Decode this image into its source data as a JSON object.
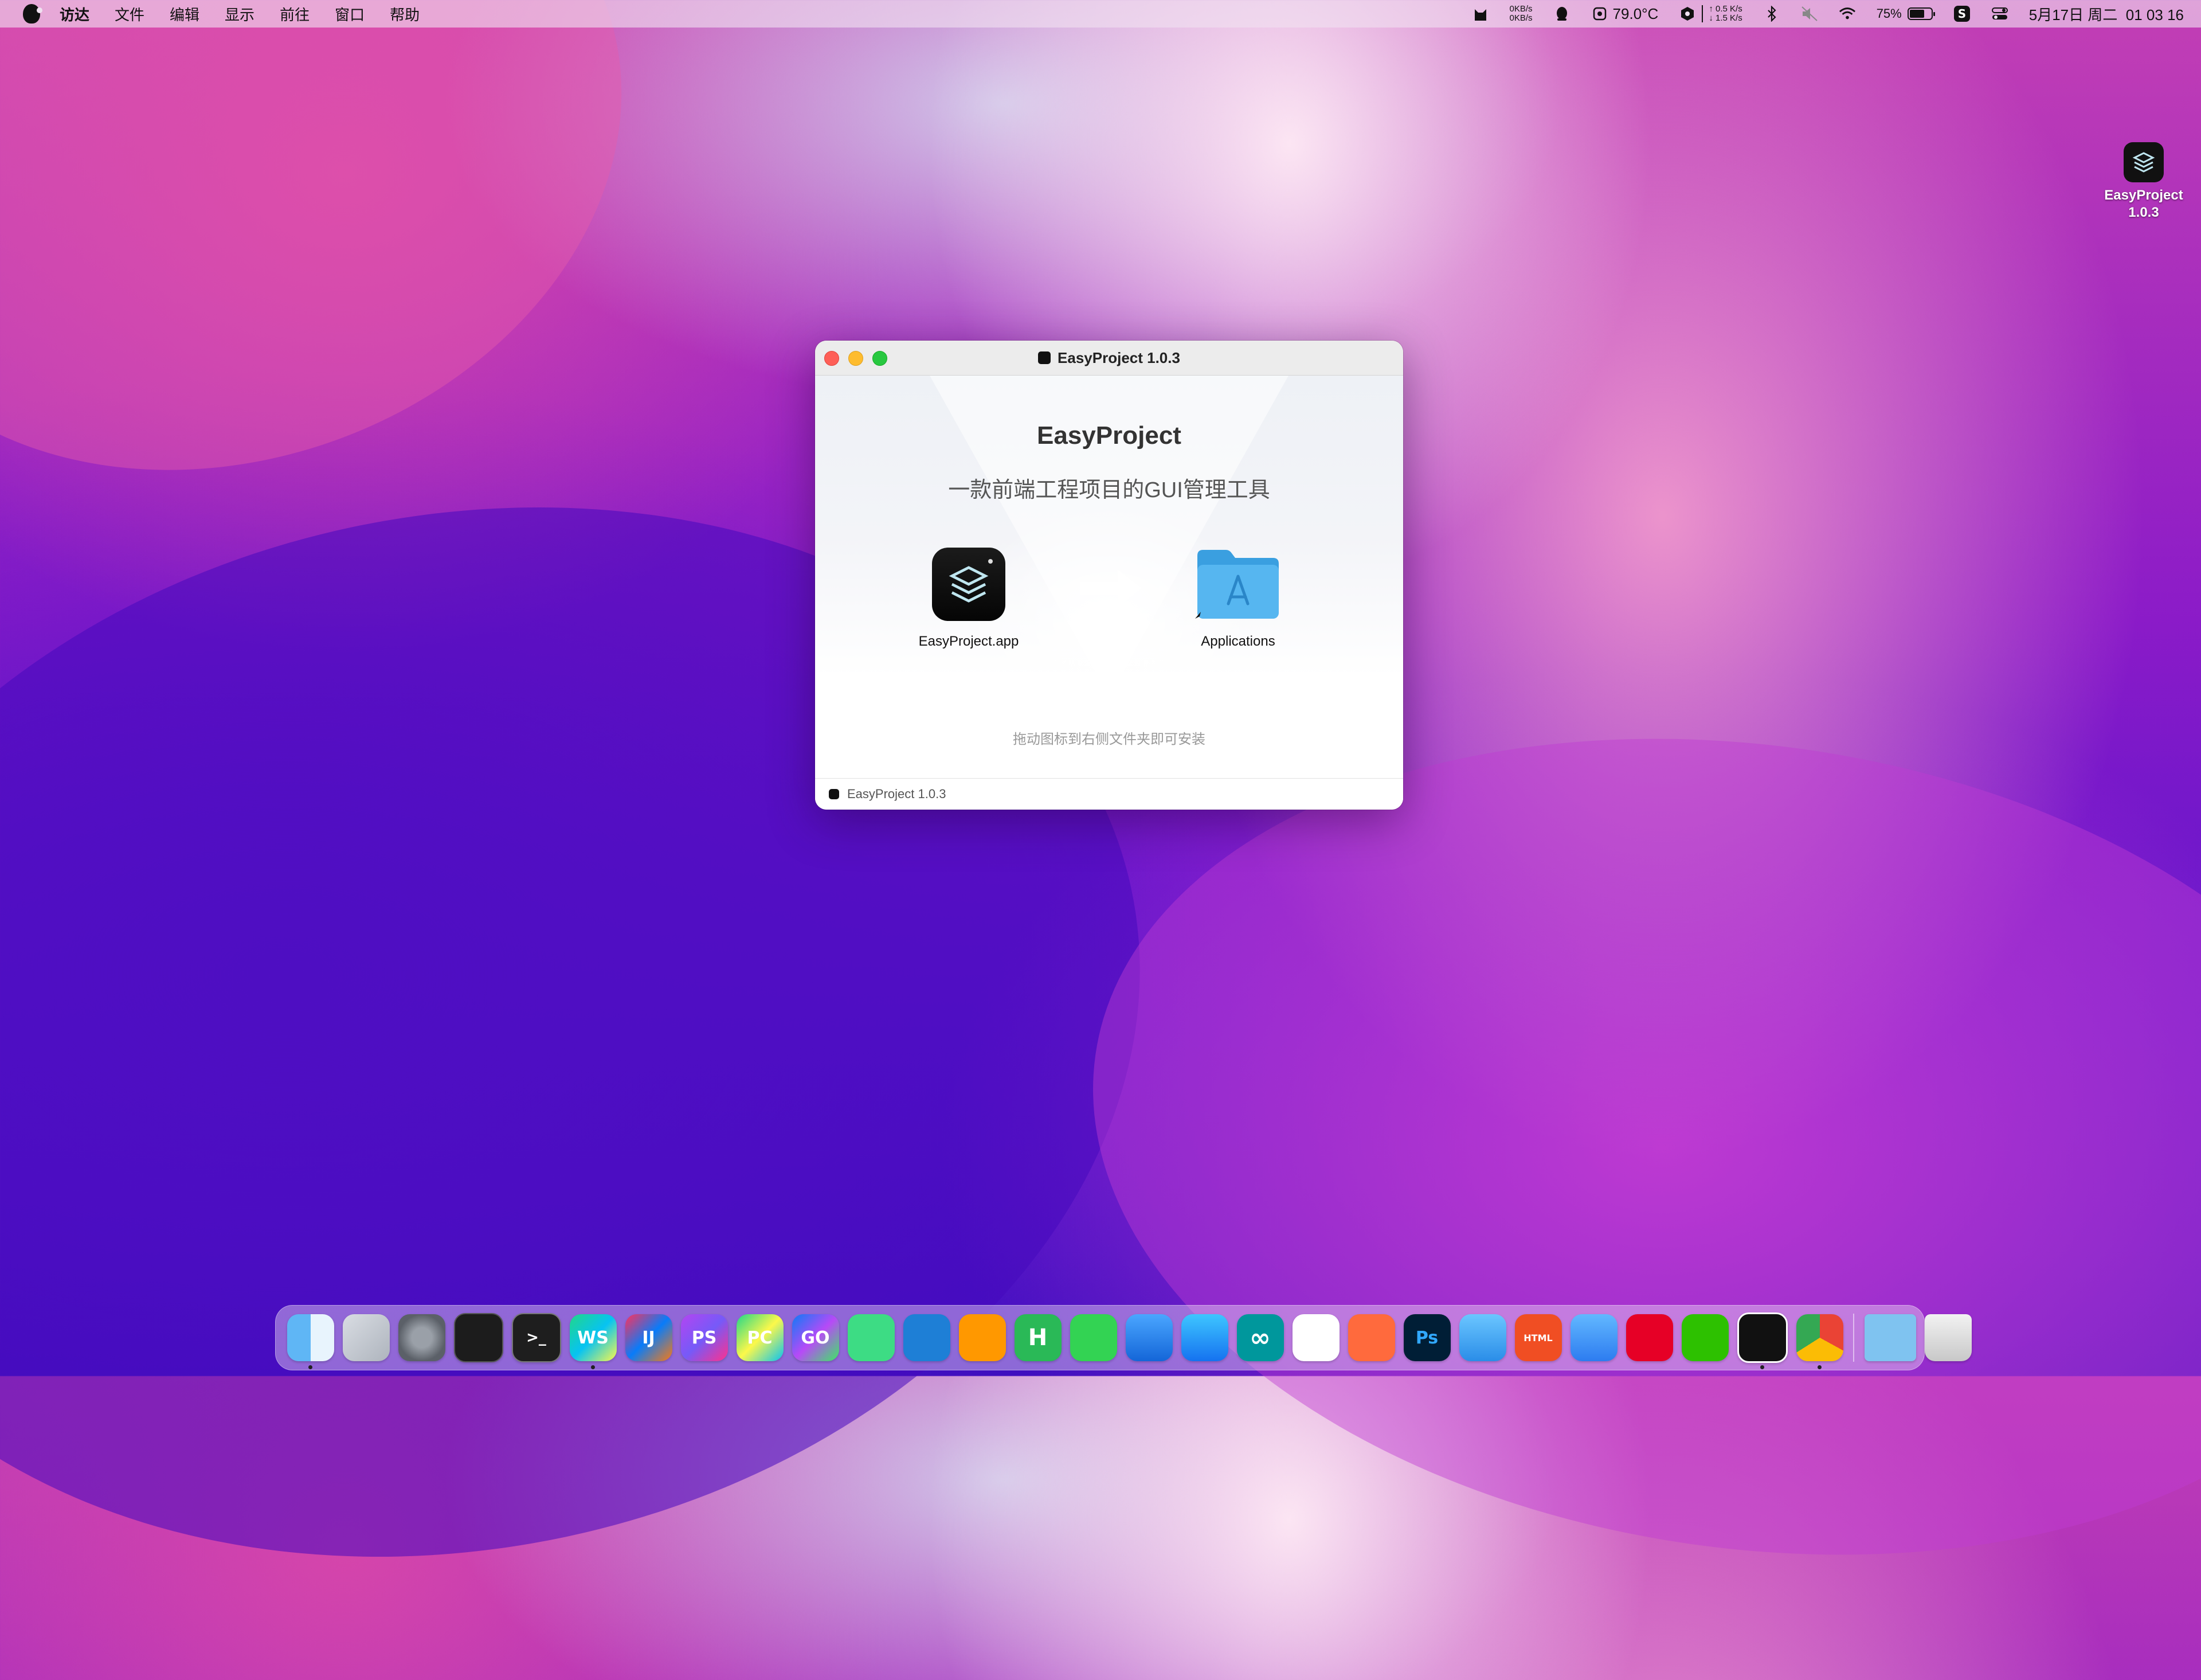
{
  "menubar": {
    "items": [
      "访达",
      "文件",
      "编辑",
      "显示",
      "前往",
      "窗口",
      "帮助"
    ],
    "net_up": "0KB/s",
    "net_down": "0KB/s",
    "temperature": "79.0°C",
    "speed_up": "↑ 0.5 K/s",
    "speed_down": "↓ 1.5 K/s",
    "battery_percent": "75%",
    "battery_level": 0.75,
    "datetime": "5月17日 周二  01 03 16"
  },
  "desktop_icon": {
    "name_line1": "EasyProject",
    "name_line2": "1.0.3"
  },
  "window": {
    "title": "EasyProject 1.0.3",
    "heading": "EasyProject",
    "subtitle": "一款前端工程项目的GUI管理工具",
    "app_label": "EasyProject.app",
    "folder_label": "Applications",
    "hint": "拖动图标到右侧文件夹即可安装",
    "status_label": "EasyProject 1.0.3"
  },
  "dock": {
    "apps": [
      {
        "name": "finder",
        "label": ""
      },
      {
        "name": "launchpad",
        "label": ""
      },
      {
        "name": "system-preferences",
        "label": ""
      },
      {
        "name": "activity-monitor",
        "label": ""
      },
      {
        "name": "terminal",
        "label": ">_"
      },
      {
        "name": "webstorm",
        "label": "WS"
      },
      {
        "name": "intellij-idea",
        "label": "IJ"
      },
      {
        "name": "phpstorm",
        "label": "PS"
      },
      {
        "name": "pycharm",
        "label": "PC"
      },
      {
        "name": "goland",
        "label": "GO"
      },
      {
        "name": "android-studio",
        "label": ""
      },
      {
        "name": "vscode",
        "label": ""
      },
      {
        "name": "sublime-text",
        "label": ""
      },
      {
        "name": "hbuilder",
        "label": "H"
      },
      {
        "name": "messages",
        "label": ""
      },
      {
        "name": "xcode",
        "label": ""
      },
      {
        "name": "app-store",
        "label": ""
      },
      {
        "name": "arduino",
        "label": "∞"
      },
      {
        "name": "photos",
        "label": ""
      },
      {
        "name": "pencil",
        "label": ""
      },
      {
        "name": "photoshop",
        "label": "Ps"
      },
      {
        "name": "database",
        "label": ""
      },
      {
        "name": "html-tool",
        "label": "HTML"
      },
      {
        "name": "cat-app",
        "label": ""
      },
      {
        "name": "netease-music",
        "label": ""
      },
      {
        "name": "wechat",
        "label": ""
      },
      {
        "name": "qq",
        "label": ""
      },
      {
        "name": "chrome",
        "label": ""
      }
    ],
    "utilities": [
      {
        "name": "folder-stack",
        "label": ""
      },
      {
        "name": "trash",
        "label": ""
      }
    ]
  }
}
